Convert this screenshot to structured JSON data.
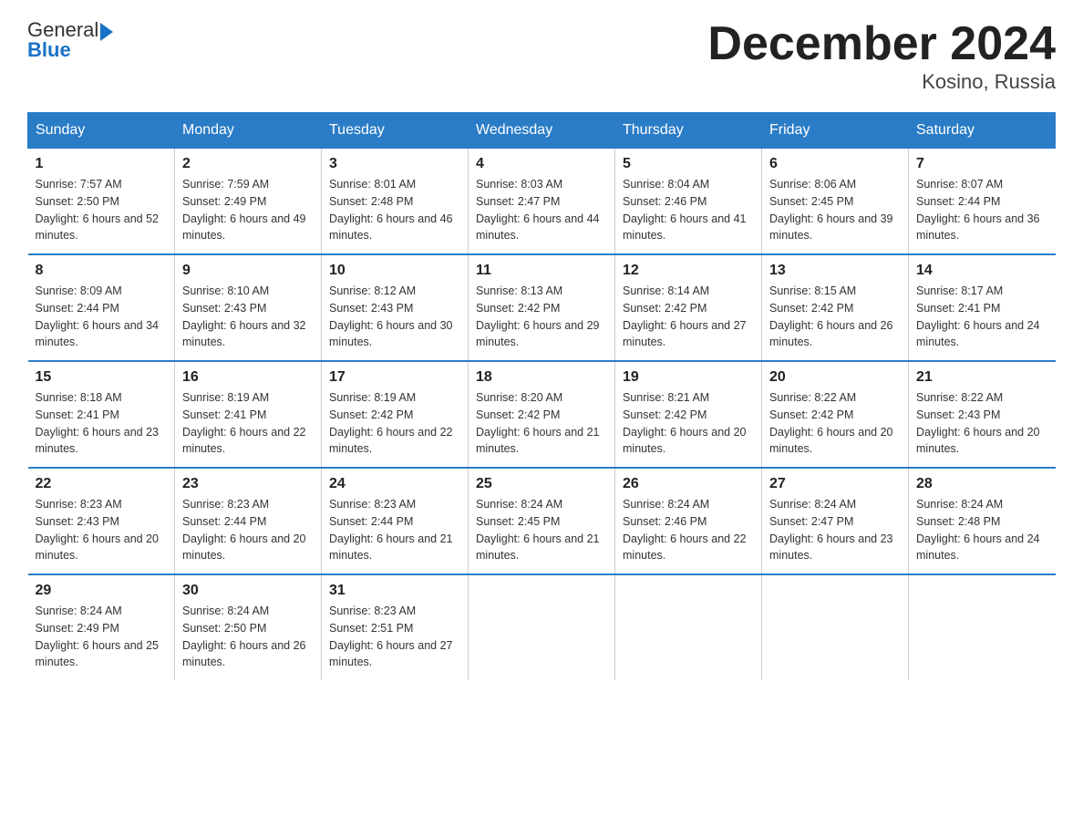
{
  "header": {
    "logo_general": "General",
    "logo_blue": "Blue",
    "month_title": "December 2024",
    "location": "Kosino, Russia"
  },
  "days_of_week": [
    "Sunday",
    "Monday",
    "Tuesday",
    "Wednesday",
    "Thursday",
    "Friday",
    "Saturday"
  ],
  "weeks": [
    [
      {
        "day": "1",
        "sunrise": "7:57 AM",
        "sunset": "2:50 PM",
        "daylight": "6 hours and 52 minutes."
      },
      {
        "day": "2",
        "sunrise": "7:59 AM",
        "sunset": "2:49 PM",
        "daylight": "6 hours and 49 minutes."
      },
      {
        "day": "3",
        "sunrise": "8:01 AM",
        "sunset": "2:48 PM",
        "daylight": "6 hours and 46 minutes."
      },
      {
        "day": "4",
        "sunrise": "8:03 AM",
        "sunset": "2:47 PM",
        "daylight": "6 hours and 44 minutes."
      },
      {
        "day": "5",
        "sunrise": "8:04 AM",
        "sunset": "2:46 PM",
        "daylight": "6 hours and 41 minutes."
      },
      {
        "day": "6",
        "sunrise": "8:06 AM",
        "sunset": "2:45 PM",
        "daylight": "6 hours and 39 minutes."
      },
      {
        "day": "7",
        "sunrise": "8:07 AM",
        "sunset": "2:44 PM",
        "daylight": "6 hours and 36 minutes."
      }
    ],
    [
      {
        "day": "8",
        "sunrise": "8:09 AM",
        "sunset": "2:44 PM",
        "daylight": "6 hours and 34 minutes."
      },
      {
        "day": "9",
        "sunrise": "8:10 AM",
        "sunset": "2:43 PM",
        "daylight": "6 hours and 32 minutes."
      },
      {
        "day": "10",
        "sunrise": "8:12 AM",
        "sunset": "2:43 PM",
        "daylight": "6 hours and 30 minutes."
      },
      {
        "day": "11",
        "sunrise": "8:13 AM",
        "sunset": "2:42 PM",
        "daylight": "6 hours and 29 minutes."
      },
      {
        "day": "12",
        "sunrise": "8:14 AM",
        "sunset": "2:42 PM",
        "daylight": "6 hours and 27 minutes."
      },
      {
        "day": "13",
        "sunrise": "8:15 AM",
        "sunset": "2:42 PM",
        "daylight": "6 hours and 26 minutes."
      },
      {
        "day": "14",
        "sunrise": "8:17 AM",
        "sunset": "2:41 PM",
        "daylight": "6 hours and 24 minutes."
      }
    ],
    [
      {
        "day": "15",
        "sunrise": "8:18 AM",
        "sunset": "2:41 PM",
        "daylight": "6 hours and 23 minutes."
      },
      {
        "day": "16",
        "sunrise": "8:19 AM",
        "sunset": "2:41 PM",
        "daylight": "6 hours and 22 minutes."
      },
      {
        "day": "17",
        "sunrise": "8:19 AM",
        "sunset": "2:42 PM",
        "daylight": "6 hours and 22 minutes."
      },
      {
        "day": "18",
        "sunrise": "8:20 AM",
        "sunset": "2:42 PM",
        "daylight": "6 hours and 21 minutes."
      },
      {
        "day": "19",
        "sunrise": "8:21 AM",
        "sunset": "2:42 PM",
        "daylight": "6 hours and 20 minutes."
      },
      {
        "day": "20",
        "sunrise": "8:22 AM",
        "sunset": "2:42 PM",
        "daylight": "6 hours and 20 minutes."
      },
      {
        "day": "21",
        "sunrise": "8:22 AM",
        "sunset": "2:43 PM",
        "daylight": "6 hours and 20 minutes."
      }
    ],
    [
      {
        "day": "22",
        "sunrise": "8:23 AM",
        "sunset": "2:43 PM",
        "daylight": "6 hours and 20 minutes."
      },
      {
        "day": "23",
        "sunrise": "8:23 AM",
        "sunset": "2:44 PM",
        "daylight": "6 hours and 20 minutes."
      },
      {
        "day": "24",
        "sunrise": "8:23 AM",
        "sunset": "2:44 PM",
        "daylight": "6 hours and 21 minutes."
      },
      {
        "day": "25",
        "sunrise": "8:24 AM",
        "sunset": "2:45 PM",
        "daylight": "6 hours and 21 minutes."
      },
      {
        "day": "26",
        "sunrise": "8:24 AM",
        "sunset": "2:46 PM",
        "daylight": "6 hours and 22 minutes."
      },
      {
        "day": "27",
        "sunrise": "8:24 AM",
        "sunset": "2:47 PM",
        "daylight": "6 hours and 23 minutes."
      },
      {
        "day": "28",
        "sunrise": "8:24 AM",
        "sunset": "2:48 PM",
        "daylight": "6 hours and 24 minutes."
      }
    ],
    [
      {
        "day": "29",
        "sunrise": "8:24 AM",
        "sunset": "2:49 PM",
        "daylight": "6 hours and 25 minutes."
      },
      {
        "day": "30",
        "sunrise": "8:24 AM",
        "sunset": "2:50 PM",
        "daylight": "6 hours and 26 minutes."
      },
      {
        "day": "31",
        "sunrise": "8:23 AM",
        "sunset": "2:51 PM",
        "daylight": "6 hours and 27 minutes."
      },
      null,
      null,
      null,
      null
    ]
  ]
}
